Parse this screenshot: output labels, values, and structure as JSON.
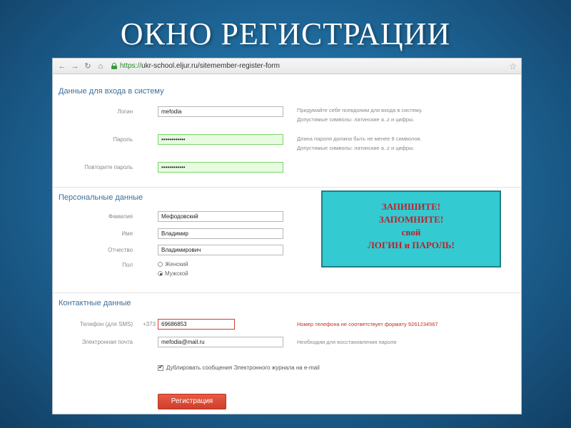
{
  "slide": {
    "title": "ОКНО РЕГИСТРАЦИИ"
  },
  "browser": {
    "url_https": "https://",
    "url_rest": "ukr-school.eljur.ru/sitemember-register-form"
  },
  "login_section": {
    "title": "Данные для входа в систему",
    "login_label": "Логин",
    "login_value": "mefodia",
    "login_hint_1": "Придумайте себе псевдоним для входа в систему.",
    "login_hint_2": "Допустимые символы: латинские a..z и цифры.",
    "password_label": "Пароль",
    "password_value": "••••••••••••",
    "password_hint_1": "Длина пароля должна быть не менее 8 символов.",
    "password_hint_2": "Допустимые символы: латинские a..z и цифры.",
    "repeat_label": "Повторите пароль",
    "repeat_value": "••••••••••••"
  },
  "personal_section": {
    "title": "Персональные данные",
    "surname_label": "Фамилия",
    "surname_value": "Мефодовский",
    "name_label": "Имя",
    "name_value": "Владимир",
    "patronymic_label": "Отчество",
    "patronymic_value": "Владимирович",
    "gender_label": "Пол",
    "gender_female": "Женский",
    "gender_male": "Мужской",
    "gender_selected": "Мужской"
  },
  "contact_section": {
    "title": "Контактные данные",
    "phone_label": "Телефон (для SMS)",
    "phone_prefix": "+373",
    "phone_value": "69686853",
    "phone_error": "Номер телефона не соответствует формату 9261234567",
    "email_label": "Электронная почта",
    "email_value": "mefodia@mail.ru",
    "email_hint": "Необходим для восстановления пароля",
    "duplicate_label": "Дублировать сообщения Электронного журнала на e-mail",
    "duplicate_checked": true
  },
  "submit_label": "Регистрация",
  "callout": {
    "line1": "ЗАПИШИТЕ!",
    "line2": "ЗАПОМНИТЕ!",
    "line3": "свой",
    "line4": "ЛОГИН и ПАРОЛЬ!"
  },
  "colors": {
    "background": "#1f6a9c",
    "callout_bg": "#33cad1",
    "callout_text": "#c0212a",
    "submit_button": "#d94a34",
    "valid_field": "#e7fbe0",
    "error_text": "#c0332b",
    "section_title": "#3c6f9c"
  },
  "icons": [
    "back-arrow-icon",
    "forward-arrow-icon",
    "reload-icon",
    "home-icon",
    "lock-icon",
    "star-icon"
  ]
}
